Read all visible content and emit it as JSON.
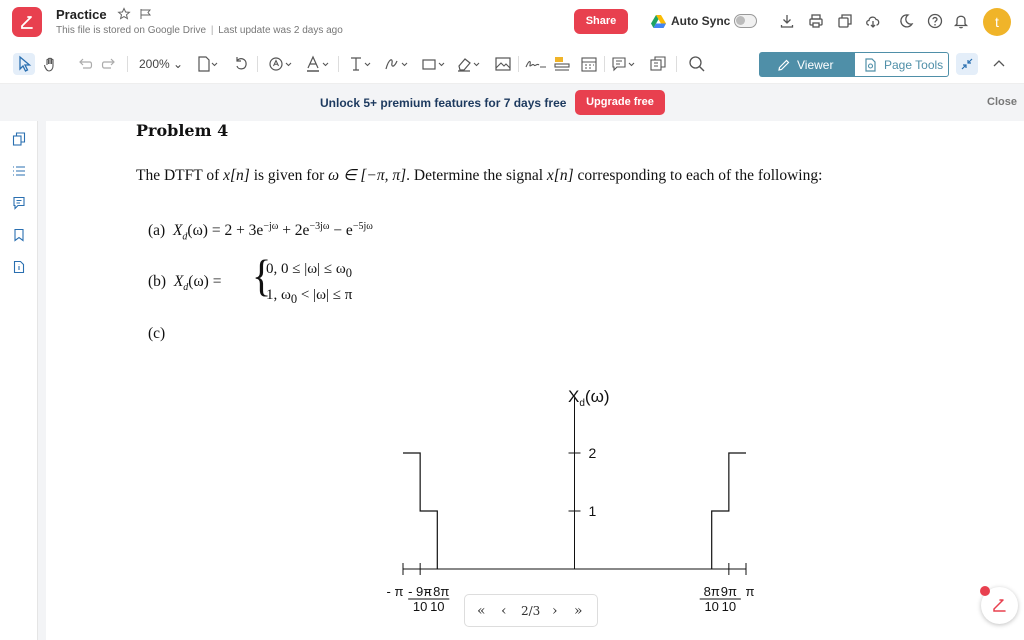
{
  "header": {
    "title": "Practice",
    "subtitle_storage": "This file is stored on Google Drive",
    "subtitle_separator": "|",
    "subtitle_update": "Last update was 2 days ago",
    "share_label": "Share",
    "autosync_label": "Auto Sync",
    "autosync_on": false,
    "avatar_letter": "t",
    "brand_color": "#e8404f",
    "avatar_color": "#f0b429"
  },
  "toolbar": {
    "zoom": "200%",
    "viewer_label": "Viewer",
    "page_tools_label": "Page Tools",
    "accent": "#4f8fa8"
  },
  "banner": {
    "text": "Unlock 5+ premium features for 7 days free",
    "upgrade_label": "Upgrade free",
    "close_label": "Close"
  },
  "sidebar": {
    "items": [
      "pages-icon",
      "outline-icon",
      "comments-icon",
      "bookmark-icon",
      "document-info-icon"
    ]
  },
  "document": {
    "problem_title": "Problem 4",
    "intro_a": "The DTFT of ",
    "intro_b": " is given for ",
    "intro_c": ". Determine the signal ",
    "intro_d": " corresponding to each of the following:",
    "var_x": "x[n]",
    "domain": "ω ∈ [−π, π]",
    "part_a_label": "(a)",
    "part_a_lhs": "X",
    "part_a_sub": "d",
    "part_a_eq": "(ω) = 2 + 3e",
    "part_a_exp1": "−jω",
    "part_a_mid": " + 2e",
    "part_a_exp2": "−3jω",
    "part_a_tail": " − e",
    "part_a_exp3": "−5jω",
    "part_b_label": "(b)",
    "part_b_lhs": "X",
    "part_b_sub": "d",
    "part_b_eq": "(ω) =",
    "part_b_case1": "0,    0 ≤ |ω| ≤ ω",
    "part_b_case1_sub": "0",
    "part_b_case2": "1,    ω",
    "part_b_case2_sub": "0",
    "part_b_case2_tail": " < |ω| ≤ π",
    "part_c_label": "(c)"
  },
  "chart_data": {
    "type": "line",
    "title": "",
    "ylabel": "Xd(ω)",
    "ylabel_main": "X",
    "ylabel_sub": "d",
    "ylabel_tail": "(ω)",
    "ytick_labels": [
      "1",
      "2"
    ],
    "yticks": [
      1,
      2
    ],
    "xtick_labels": [
      "- π",
      "- 9π / 10",
      "- 8π / 10",
      "8π / 10",
      "9π / 10",
      "π"
    ],
    "xlim": [
      -1,
      1
    ],
    "ylim": [
      0,
      3
    ],
    "series": [
      {
        "x": [
          -1.0,
          -0.9,
          -0.9,
          -0.8,
          -0.8,
          0.8,
          0.8,
          0.9,
          0.9,
          1.0
        ],
        "y": [
          2,
          2,
          1,
          1,
          0,
          0,
          1,
          1,
          2,
          2
        ]
      }
    ]
  },
  "pagenav": {
    "page_indicator": "2/3"
  }
}
